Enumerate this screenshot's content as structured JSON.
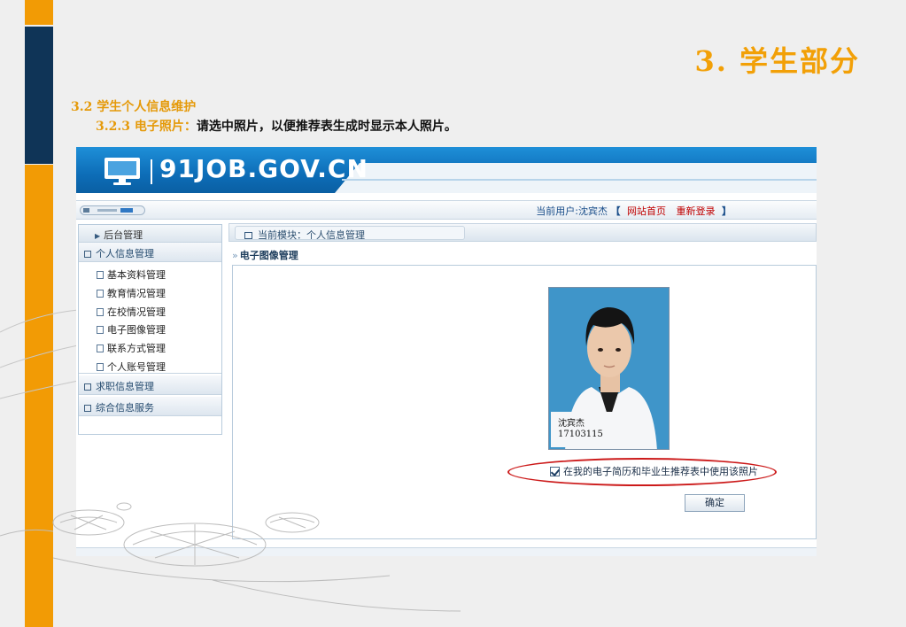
{
  "slide": {
    "title": "3. 学生部分",
    "section": "3.2 学生个人信息维护",
    "subsection_label": "3.2.3 电子照片：",
    "subsection_desc": "请选中照片，以便推荐表生成时显示本人照片。"
  },
  "colors": {
    "accent_orange": "#f29b05",
    "navy": "#0f3457",
    "banner_blue": "#0d6db7",
    "link_red": "#c00000",
    "highlight_ellipse": "#cc1a1a"
  },
  "app": {
    "logo_text": "91JOB.GOV.CN",
    "user_label": "当前用户:沈宾杰",
    "bracket_open": "【",
    "bracket_close": "】",
    "home_link": "网站首页",
    "relogin_link": "重新登录"
  },
  "sidebar": {
    "header": "后台管理",
    "groups": [
      {
        "label": "个人信息管理",
        "items": [
          "基本资料管理",
          "教育情况管理",
          "在校情况管理",
          "电子图像管理",
          "联系方式管理",
          "个人账号管理"
        ]
      },
      {
        "label": "求职信息管理"
      },
      {
        "label": "综合信息服务"
      }
    ]
  },
  "main": {
    "module": "当前模块：个人信息管理",
    "page_title": "电子图像管理",
    "photo_caption_name": "沈宾杰",
    "photo_caption_id": "17103115",
    "checkbox_label": "在我的电子简历和毕业生推荐表中使用该照片",
    "checkbox_checked": true,
    "confirm_button": "确定"
  }
}
